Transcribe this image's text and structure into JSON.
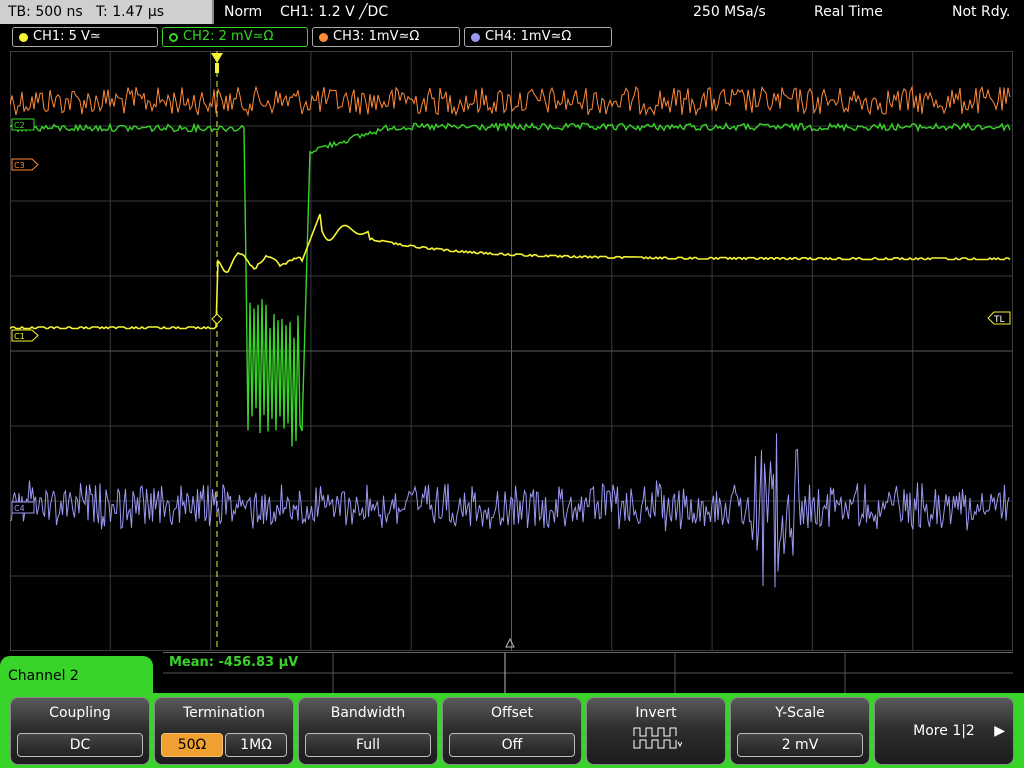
{
  "topbar": {
    "timebase": "TB: 500 ns",
    "trigger_time": "T: 1.47 µs",
    "mode": "Norm",
    "trigger": "CH1: 1.2 V ╱DC",
    "sample_rate": "250 MSa/s",
    "acq_mode": "Real Time",
    "status": "Not Rdy."
  },
  "channels": [
    {
      "label": "CH1: 5 V≃",
      "color": "#f5f536"
    },
    {
      "label": "CH2: 2 mV≃Ω",
      "color": "#39d42a"
    },
    {
      "label": "CH3: 1mV≃Ω",
      "color": "#ff8a3a"
    },
    {
      "label": "CH4: 1mV≃Ω",
      "color": "#9a98f0"
    }
  ],
  "markers": {
    "c1": "C1",
    "c2": "C2",
    "c3": "C3",
    "c4": "C4",
    "trigger_level": "TL"
  },
  "measurement": {
    "mean": "Mean: -456.83 µV"
  },
  "menu": {
    "channel_tab": "Channel 2",
    "coupling": {
      "title": "Coupling",
      "value": "DC"
    },
    "termination": {
      "title": "Termination",
      "opt1": "50Ω",
      "opt2": "1MΩ"
    },
    "bandwidth": {
      "title": "Bandwidth",
      "value": "Full"
    },
    "offset": {
      "title": "Offset",
      "value": "Off"
    },
    "invert": {
      "title": "Invert"
    },
    "yscale": {
      "title": "Y-Scale",
      "value": "2 mV"
    },
    "more": {
      "title": "More 1|2"
    }
  },
  "colors": {
    "ch1": "#f5f536",
    "ch2": "#39d42a",
    "ch3": "#ff8a3a",
    "ch4": "#9a98f0",
    "menu_accent": "#39d42a"
  }
}
